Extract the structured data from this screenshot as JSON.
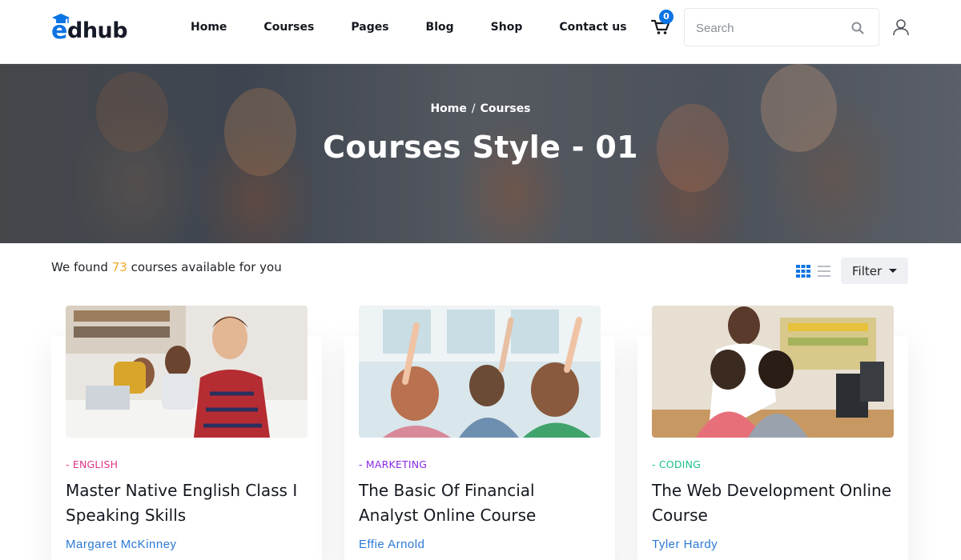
{
  "header": {
    "logo_letter": "e",
    "logo_rest": "dhub",
    "nav": [
      "Home",
      "Courses",
      "Pages",
      "Blog",
      "Shop",
      "Contact us"
    ],
    "cart_count": "0",
    "search_placeholder": "Search"
  },
  "banner": {
    "breadcrumb_home": "Home",
    "breadcrumb_sep": "/",
    "breadcrumb_current": "Courses",
    "title": "Courses Style - 01"
  },
  "results": {
    "prefix": "We found ",
    "count": "73",
    "suffix": " courses available for you"
  },
  "filter": {
    "label": "Filter"
  },
  "courses": [
    {
      "category": "- ENGLISH",
      "title": "Master Native English Class I Speaking Skills",
      "author": "Margaret McKinney"
    },
    {
      "category": "- MARKETING",
      "title": "The Basic Of Financial Analyst Online Course",
      "author": "Effie Arnold"
    },
    {
      "category": "- CODING",
      "title": "The Web Development Online Course",
      "author": "Tyler Hardy"
    }
  ],
  "colors": {
    "primary": "#0d74e3",
    "count_highlight": "#f2a72c",
    "author": "#2b79d6",
    "cat_english": "#e0368a",
    "cat_marketing": "#8a2be2",
    "cat_coding": "#1bbf8f"
  },
  "icons": [
    "graduation-cap-icon",
    "cart-icon",
    "search-icon",
    "user-icon",
    "grid-view-icon",
    "list-view-icon",
    "caret-down-icon"
  ]
}
